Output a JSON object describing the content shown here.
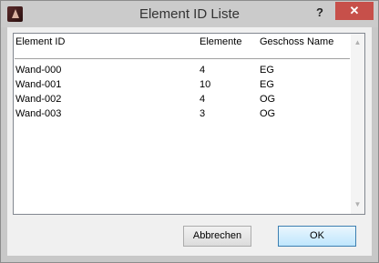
{
  "window": {
    "title": "Element ID Liste",
    "help_label": "?",
    "close_label": "✕"
  },
  "list": {
    "columns": [
      "Element ID",
      "Elemente",
      "Geschoss Name"
    ],
    "rows": [
      {
        "id": "Wand-000",
        "count": "4",
        "floor": "EG"
      },
      {
        "id": "Wand-001",
        "count": "10",
        "floor": "EG"
      },
      {
        "id": "Wand-002",
        "count": "4",
        "floor": "OG"
      },
      {
        "id": "Wand-003",
        "count": "3",
        "floor": "OG"
      }
    ]
  },
  "buttons": {
    "cancel_label": "Abbrechen",
    "ok_label": "OK"
  },
  "colors": {
    "close": "#c7504a",
    "titlebar": "#cbcbcb"
  }
}
